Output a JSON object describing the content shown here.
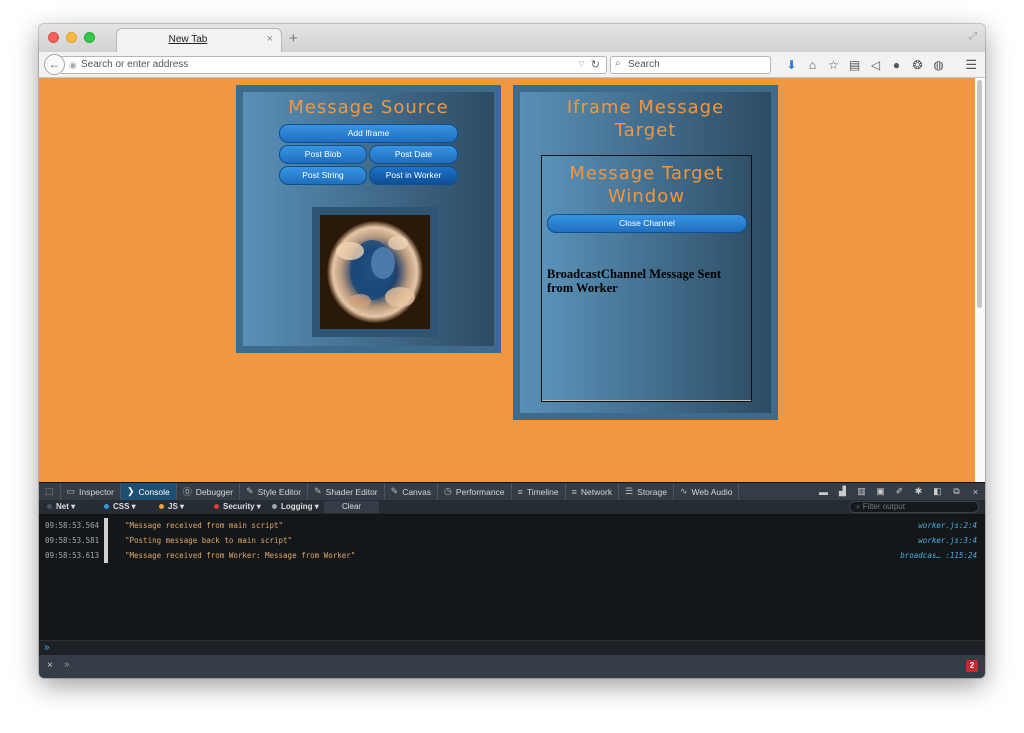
{
  "browser": {
    "tab_title": "New Tab",
    "tab_close": "×",
    "new_tab": "+",
    "url_placeholder": "Search or enter address",
    "search_placeholder": "Search",
    "icons": [
      "download-icon",
      "home-icon",
      "bookmark-star-icon",
      "reading-list-icon",
      "pocket-icon",
      "extension-icon",
      "extension-icon",
      "chat-icon"
    ]
  },
  "page": {
    "source_title": "Message Source",
    "buttons": {
      "add_iframe": "Add Iframe",
      "post_blob": "Post Blob",
      "post_date": "Post Date",
      "post_string": "Post String",
      "post_in_worker": "Post in Worker"
    },
    "target_title": "Iframe Message Target",
    "target_window_title": "Message Target Window",
    "close_channel": "Close Channel",
    "message_text": "BroadcastChannel Message Sent from Worker",
    "colors": {
      "page_bg": "#f1973f",
      "panel_accent": "#f1973f"
    }
  },
  "devtools": {
    "tabs": {
      "inspector": "Inspector",
      "console": "Console",
      "debugger": "Debugger",
      "style_editor": "Style Editor",
      "shader_editor": "Shader Editor",
      "canvas": "Canvas",
      "performance": "Performance",
      "timeline": "Timeline",
      "network": "Network",
      "storage": "Storage",
      "web_audio": "Web Audio"
    },
    "filters": {
      "net": "Net",
      "css": "CSS",
      "js": "JS",
      "security": "Security",
      "logging": "Logging",
      "clear": "Clear",
      "filter_placeholder": "Filter output"
    },
    "rows": [
      {
        "time": "09:58:53.564",
        "message": "\"Message received from main script\"",
        "location": "worker.js:2:4"
      },
      {
        "time": "09:58:53.581",
        "message": "\"Posting message back to main script\"",
        "location": "worker.js:3:4"
      },
      {
        "time": "09:58:53.613",
        "message": "\"Message received from Worker: Message from Worker\"",
        "location": "broadcas… :115:24"
      }
    ],
    "error_count": "2"
  }
}
